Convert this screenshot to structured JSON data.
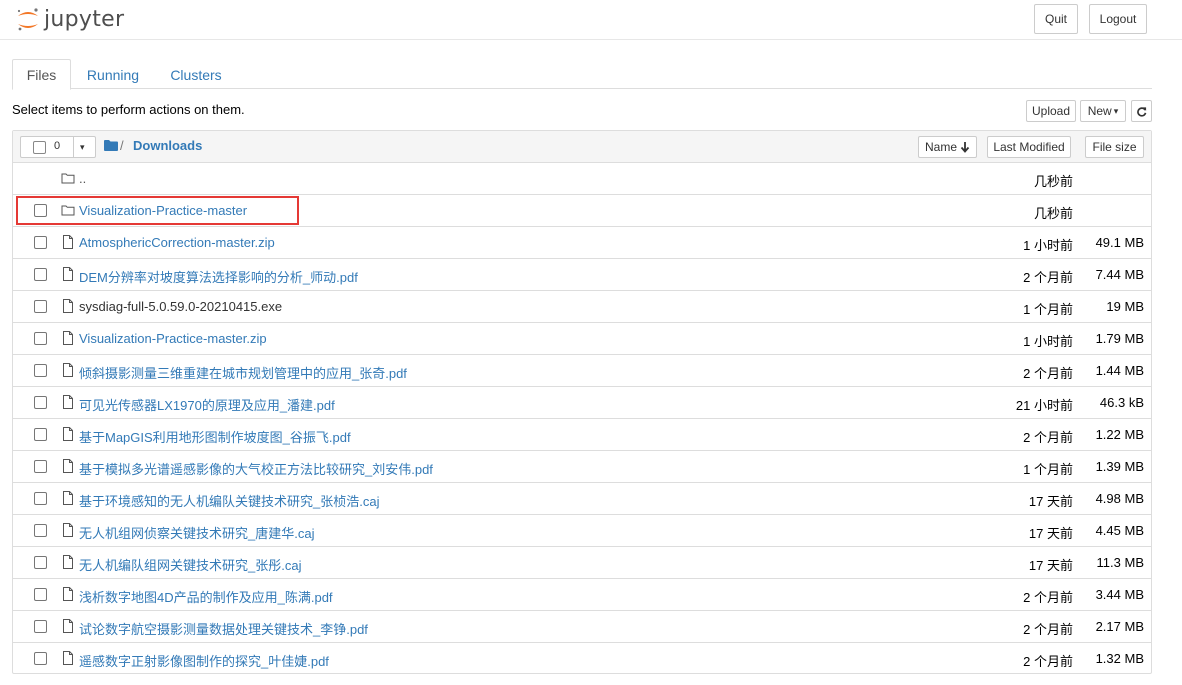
{
  "header": {
    "logo_text": "jupyter",
    "quit_label": "Quit",
    "logout_label": "Logout"
  },
  "tabs": [
    {
      "label": "Files"
    },
    {
      "label": "Running"
    },
    {
      "label": "Clusters"
    }
  ],
  "instructions": "Select items to perform actions on them.",
  "toolbar": {
    "upload_label": "Upload",
    "new_label": "New",
    "new_caret": "▾",
    "refresh_icon": "refresh-icon"
  },
  "list_header": {
    "selected_count": "0",
    "caret": "▾",
    "breadcrumb_separator": "/",
    "breadcrumb_folder": "Downloads",
    "sort_name_label": "Name",
    "sort_name_arrow": "🡓",
    "sort_modified_label": "Last Modified",
    "sort_size_label": "File size"
  },
  "rows": [
    {
      "type": "parent",
      "name": "..",
      "modified": "几秒前",
      "size": ""
    },
    {
      "type": "folder",
      "name": "Visualization-Practice-master",
      "modified": "几秒前",
      "size": ""
    },
    {
      "type": "file",
      "name": "AtmosphericCorrection-master.zip",
      "modified": "1 小时前",
      "size": "49.1 MB"
    },
    {
      "type": "file",
      "name": "DEM分辨率对坡度算法选择影响的分析_师动.pdf",
      "modified": "2 个月前",
      "size": "7.44 MB"
    },
    {
      "type": "file",
      "name": "sysdiag-full-5.0.59.0-20210415.exe",
      "modified": "1 个月前",
      "size": "19 MB"
    },
    {
      "type": "file",
      "name": "Visualization-Practice-master.zip",
      "modified": "1 小时前",
      "size": "1.79 MB"
    },
    {
      "type": "file",
      "name": "倾斜摄影测量三维重建在城市规划管理中的应用_张奇.pdf",
      "modified": "2 个月前",
      "size": "1.44 MB"
    },
    {
      "type": "file",
      "name": "可见光传感器LX1970的原理及应用_潘建.pdf",
      "modified": "21 小时前",
      "size": "46.3 kB"
    },
    {
      "type": "file",
      "name": "基于MapGIS利用地形图制作坡度图_谷振飞.pdf",
      "modified": "2 个月前",
      "size": "1.22 MB"
    },
    {
      "type": "file",
      "name": "基于模拟多光谱遥感影像的大气校正方法比较研究_刘安伟.pdf",
      "modified": "1 个月前",
      "size": "1.39 MB"
    },
    {
      "type": "file",
      "name": "基于环境感知的无人机编队关键技术研究_张桢浩.caj",
      "modified": "17 天前",
      "size": "4.98 MB"
    },
    {
      "type": "file",
      "name": "无人机组网侦察关键技术研究_唐建华.caj",
      "modified": "17 天前",
      "size": "4.45 MB"
    },
    {
      "type": "file",
      "name": "无人机编队组网关键技术研究_张彤.caj",
      "modified": "17 天前",
      "size": "11.3 MB"
    },
    {
      "type": "file",
      "name": "浅析数字地图4D产品的制作及应用_陈满.pdf",
      "modified": "2 个月前",
      "size": "3.44 MB"
    },
    {
      "type": "file",
      "name": "试论数字航空摄影测量数据处理关键技术_李铮.pdf",
      "modified": "2 个月前",
      "size": "2.17 MB"
    },
    {
      "type": "file",
      "name": "遥感数字正射影像图制作的探究_叶佳婕.pdf",
      "modified": "2 个月前",
      "size": "1.32 MB"
    }
  ],
  "colors": {
    "link": "#337ab7",
    "highlight": "#e53935",
    "logo_orange": "#f37726"
  }
}
